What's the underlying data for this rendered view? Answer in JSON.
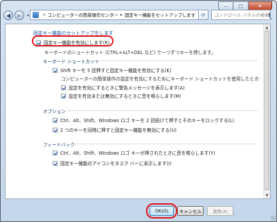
{
  "window": {
    "caption_buttons": {
      "minimize": "–",
      "maximize": "□",
      "close": "✕"
    },
    "nav": {
      "back_icon": "◀",
      "forward_icon": "▶",
      "dropdown_icon": "▾"
    },
    "address": {
      "prefix": "«",
      "segments": [
        "コンピューターの簡単操作センター",
        "固定キー機能をセットアップします"
      ],
      "separator": "▸",
      "dropdown_icon": "▾",
      "refresh_icon": "⟳"
    },
    "search": {
      "placeholder": "コントロール パネルの検索"
    }
  },
  "main": {
    "title": "固定キー機能のセットアップをします",
    "enable_checkbox": {
      "label": "固定キー機能を有効にします(R)",
      "checked": true
    },
    "enable_note": "キーボードのショートカット (CTRL+ALT+DEL など) で一つずつキーを押します。",
    "groups": [
      {
        "heading": "キーボード ショートカット",
        "items": [
          {
            "label": "Shift キーを 5 回押すと固定キー機能を有効にする(K)",
            "checked": true,
            "indent": 0
          }
        ],
        "note": "コンピューターの簡単操作の設定を有効にするためにキーボード ショートカットを使用したとき:",
        "subitems": [
          {
            "label": "設定を有効にするときに警告メッセージを表示します(A)",
            "checked": true
          },
          {
            "label": "設定を有効または無効にするときに音を鳴らします(M)",
            "checked": true
          }
        ]
      },
      {
        "heading": "オプション",
        "items": [
          {
            "label": "Ctrl、Alt、Shift、Windows ロゴ キーを 2 回続けて押すとそのキーをロックする(L)",
            "checked": true
          },
          {
            "label": "2 つのキーを同時に押すと固定キー機能を無効にする(U)",
            "checked": true
          }
        ]
      },
      {
        "heading": "フィードバック",
        "items": [
          {
            "label": "Ctrl、Alt、Shift、Windows ロゴ キーが押されたときに音を鳴らします(Y)",
            "checked": true
          },
          {
            "label": "固定キー機能のアイコンをタスク バーに表示します(I)",
            "checked": true
          }
        ]
      }
    ]
  },
  "footer": {
    "ok_label": "OK(O)",
    "cancel_label": "キャンセル",
    "apply_label": "適用(A)"
  },
  "highlight_color": "#e0141c"
}
